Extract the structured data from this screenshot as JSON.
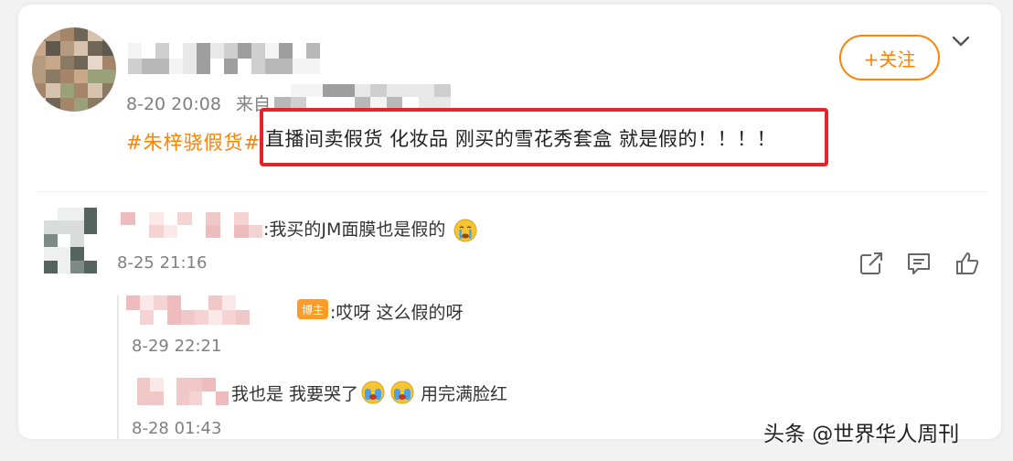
{
  "post": {
    "time": "8-20 20:08",
    "source_prefix": "来自",
    "hashtag": "#朱梓骁假货#",
    "text": "直播间卖假货 化妆品 刚买的雪花秀套盒 就是假的！！！！",
    "follow_label": "+关注"
  },
  "comments": [
    {
      "text": ":我买的JM面膜也是假的",
      "time": "8-25 21:16"
    }
  ],
  "replies": [
    {
      "badge": "博主",
      "text": ":哎呀 这么假的呀",
      "time": "8-29 22:21"
    },
    {
      "text_a": "我也是 我要哭了",
      "text_b": "用完满脸红",
      "time": "8-28 01:43"
    }
  ],
  "watermark": "头条 @世界华人周刊",
  "colors": {
    "accent": "#ff8200",
    "highlight_box": "#e4232b",
    "badge": "#ff9b28"
  },
  "icons": [
    "chevron-down-icon",
    "share-icon",
    "comment-icon",
    "like-icon",
    "crying-emoji-icon",
    "tears-emoji-icon"
  ]
}
